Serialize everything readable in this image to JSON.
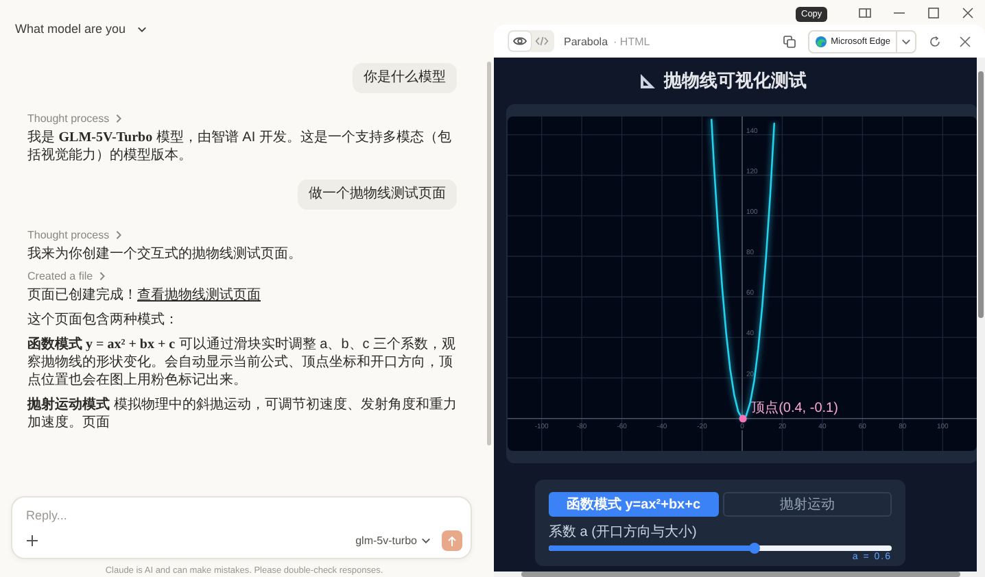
{
  "chat": {
    "title": "What model are you",
    "messages": [
      {
        "kind": "user",
        "text": "你是什么模型"
      },
      {
        "kind": "status",
        "text": "Thought process"
      },
      {
        "kind": "paragraph",
        "text": "我是 **GLM-5V-Turbo** 模型，由智谱 AI 开发。这是一个支持多模态（包括视觉能力）的模型版本。"
      },
      {
        "kind": "user",
        "text": "做一个抛物线测试页面"
      },
      {
        "kind": "status",
        "text": "Thought process"
      },
      {
        "kind": "paragraph",
        "text": "我来为你创建一个交互式的抛物线测试页面。"
      },
      {
        "kind": "status",
        "text": "Created a file"
      },
      {
        "kind": "link_paragraph",
        "text": "页面已创建完成！",
        "link": "查看抛物线测试页面"
      },
      {
        "kind": "paragraph",
        "text": "这个页面包含两种模式："
      },
      {
        "kind": "paragraph",
        "text": "**函数模式 y = ax² + bx + c** 可以通过滑块实时调整 a、b、c 三个系数，观察抛物线的形状变化。会自动显示当前公式、顶点坐标和开口方向，顶点位置也会在图上用粉色标记出来。"
      },
      {
        "kind": "paragraph",
        "text": "**抛射运动模式** 模拟物理中的斜抛运动，可调节初速度、发射角度和重力加速度。页面"
      }
    ],
    "composer": {
      "placeholder": "Reply...",
      "model": "glm-5v-turbo"
    },
    "disclaimer": "Claude is AI and can make mistakes. Please double-check responses."
  },
  "artifact": {
    "tooltip": "Copy",
    "views": [
      {
        "kind": "preview",
        "selected": true
      },
      {
        "kind": "code",
        "selected": false
      }
    ],
    "name": "Parabola",
    "type": "· HTML",
    "browser": "Microsoft Edge",
    "page": {
      "title": "抛物线可视化测试",
      "chart_data": {
        "type": "line",
        "grid": true,
        "x": [
          -15.3,
          -14,
          -12,
          -10,
          -8,
          -6,
          -4,
          -2,
          0,
          0.4,
          2,
          4,
          6,
          8,
          10,
          12,
          14,
          16
        ],
        "series": [
          {
            "color": "#22d3ee",
            "values": [
              147.8,
              124.3,
              92.2,
              64.8,
              42.2,
              24.5,
              11.5,
              3.4,
              0,
              -0.1,
              1.4,
              7.7,
              18.7,
              34.6,
              55.2,
              80.6,
              110.9,
              145.9
            ]
          }
        ],
        "xlim": [
          -117,
          117
        ],
        "ylim": [
          -16,
          149
        ],
        "xticks": [
          -100,
          -80,
          -60,
          -40,
          -20,
          0,
          20,
          40,
          60,
          80,
          100
        ],
        "yticks": [
          20,
          40,
          60,
          80,
          100,
          120,
          140
        ],
        "annotations": [
          {
            "x": 0.4,
            "y": -0.1,
            "text": "顶点(0.4, -0.1)"
          }
        ]
      },
      "modes": [
        {
          "label": "函数模式 y=ax²+bx+c",
          "selected": true
        },
        {
          "label": "抛射运动",
          "selected": false
        }
      ],
      "slider": {
        "label": "系数 a (开口方向与大小)",
        "level": 0.6,
        "reading": "a = 0.6"
      }
    }
  }
}
